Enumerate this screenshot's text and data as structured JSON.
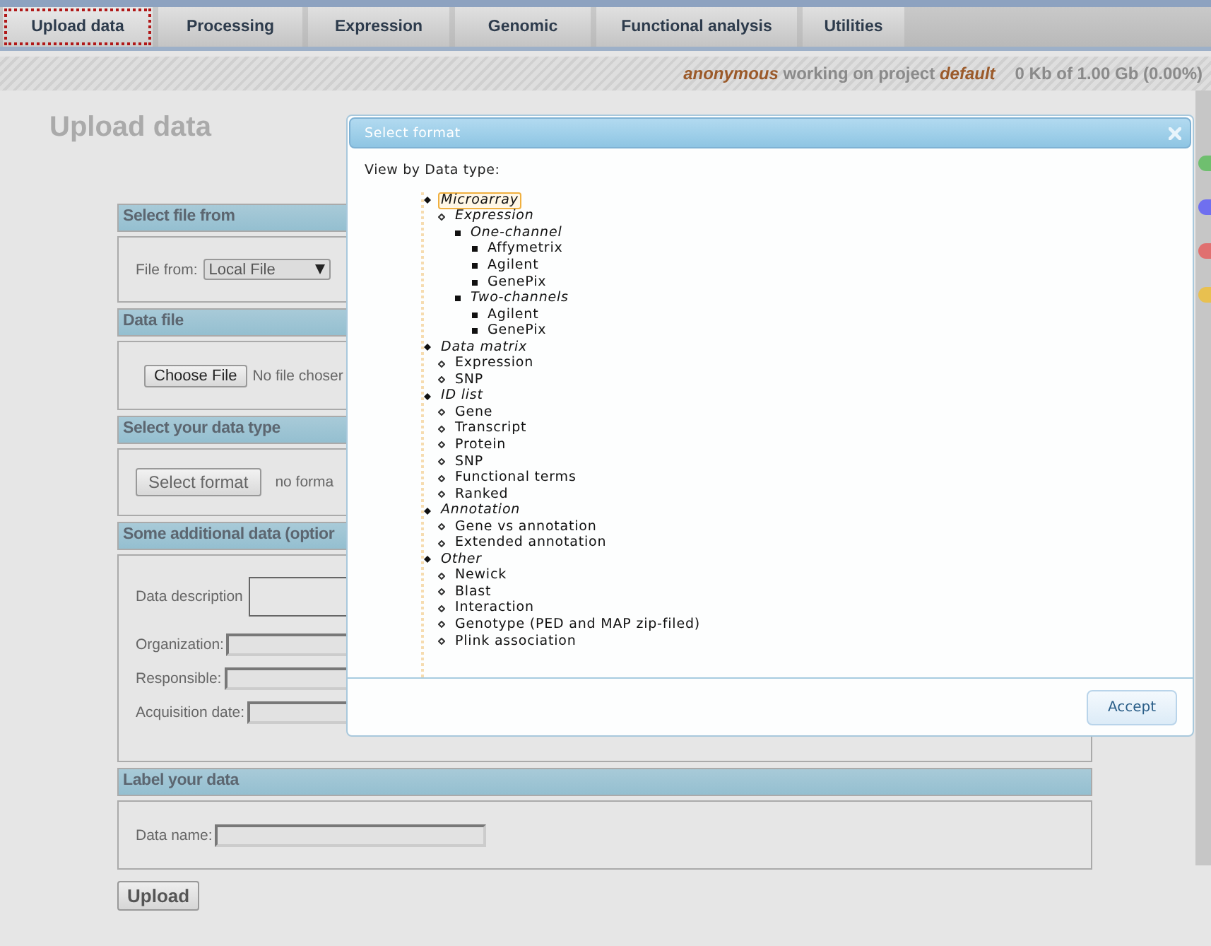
{
  "tabs": [
    {
      "label": "Upload data",
      "selected": true
    },
    {
      "label": "Processing",
      "selected": false
    },
    {
      "label": "Expression",
      "selected": false
    },
    {
      "label": "Genomic",
      "selected": false
    },
    {
      "label": "Functional analysis",
      "selected": false
    },
    {
      "label": "Utilities",
      "selected": false
    }
  ],
  "status_bar": {
    "user": "anonymous",
    "text": "working on project",
    "project": "default",
    "usage": "0 Kb of 1.00 Gb (0.00%)"
  },
  "page_title": "Upload data",
  "sections": [
    {
      "title": "Select file from",
      "fields": [
        {
          "kind": "select",
          "label": "File from:",
          "value": "Local File"
        }
      ]
    },
    {
      "title": "Data file",
      "fields": [
        {
          "kind": "file",
          "button": "Choose File",
          "status": "No file choser"
        }
      ]
    },
    {
      "title": "Select your data type",
      "fields": [
        {
          "kind": "format",
          "button": "Select format",
          "status": "no forma"
        }
      ]
    },
    {
      "title": "Some additional data (optior",
      "fields": [
        {
          "kind": "textarea",
          "label": "Data description"
        },
        {
          "kind": "input",
          "label": "Organization:"
        },
        {
          "kind": "input",
          "label": "Responsible:"
        },
        {
          "kind": "input",
          "label": "Acquisition date:"
        }
      ]
    },
    {
      "title": "Label your data",
      "fields": [
        {
          "kind": "input",
          "label": "Data name:"
        }
      ]
    }
  ],
  "upload_button": "Upload",
  "side_dots": [
    {
      "color": "#6fbf6f"
    },
    {
      "color": "#6f6fef"
    },
    {
      "color": "#e07070"
    },
    {
      "color": "#e8c050"
    }
  ],
  "dialog": {
    "title": "Select format",
    "intro": "View by Data type:",
    "accept": "Accept",
    "tree": [
      {
        "label": "Microarray",
        "selected": true,
        "children": [
          {
            "label": "Expression",
            "selected": false,
            "children": [
              {
                "label": "One-channel",
                "selected": false,
                "children": [
                  {
                    "label": "Affymetrix",
                    "selected": false
                  },
                  {
                    "label": "Agilent",
                    "selected": false
                  },
                  {
                    "label": "GenePix",
                    "selected": false
                  }
                ]
              },
              {
                "label": "Two-channels",
                "selected": false,
                "children": [
                  {
                    "label": "Agilent",
                    "selected": false
                  },
                  {
                    "label": "GenePix",
                    "selected": false
                  }
                ]
              }
            ]
          }
        ]
      },
      {
        "label": "Data matrix",
        "selected": false,
        "children": [
          {
            "label": "Expression",
            "selected": false
          },
          {
            "label": "SNP",
            "selected": false
          }
        ]
      },
      {
        "label": "ID list",
        "selected": false,
        "children": [
          {
            "label": "Gene",
            "selected": false
          },
          {
            "label": "Transcript",
            "selected": false
          },
          {
            "label": "Protein",
            "selected": false
          },
          {
            "label": "SNP",
            "selected": false
          },
          {
            "label": "Functional terms",
            "selected": false
          },
          {
            "label": "Ranked",
            "selected": false
          }
        ]
      },
      {
        "label": "Annotation",
        "selected": false,
        "children": [
          {
            "label": "Gene vs annotation",
            "selected": false
          },
          {
            "label": "Extended annotation",
            "selected": false
          }
        ]
      },
      {
        "label": "Other",
        "selected": false,
        "children": [
          {
            "label": "Newick",
            "selected": false
          },
          {
            "label": "Blast",
            "selected": false
          },
          {
            "label": "Interaction",
            "selected": false
          },
          {
            "label": "Genotype (PED and MAP zip-filed)",
            "selected": false
          },
          {
            "label": "Plink association",
            "selected": false
          }
        ]
      }
    ]
  }
}
